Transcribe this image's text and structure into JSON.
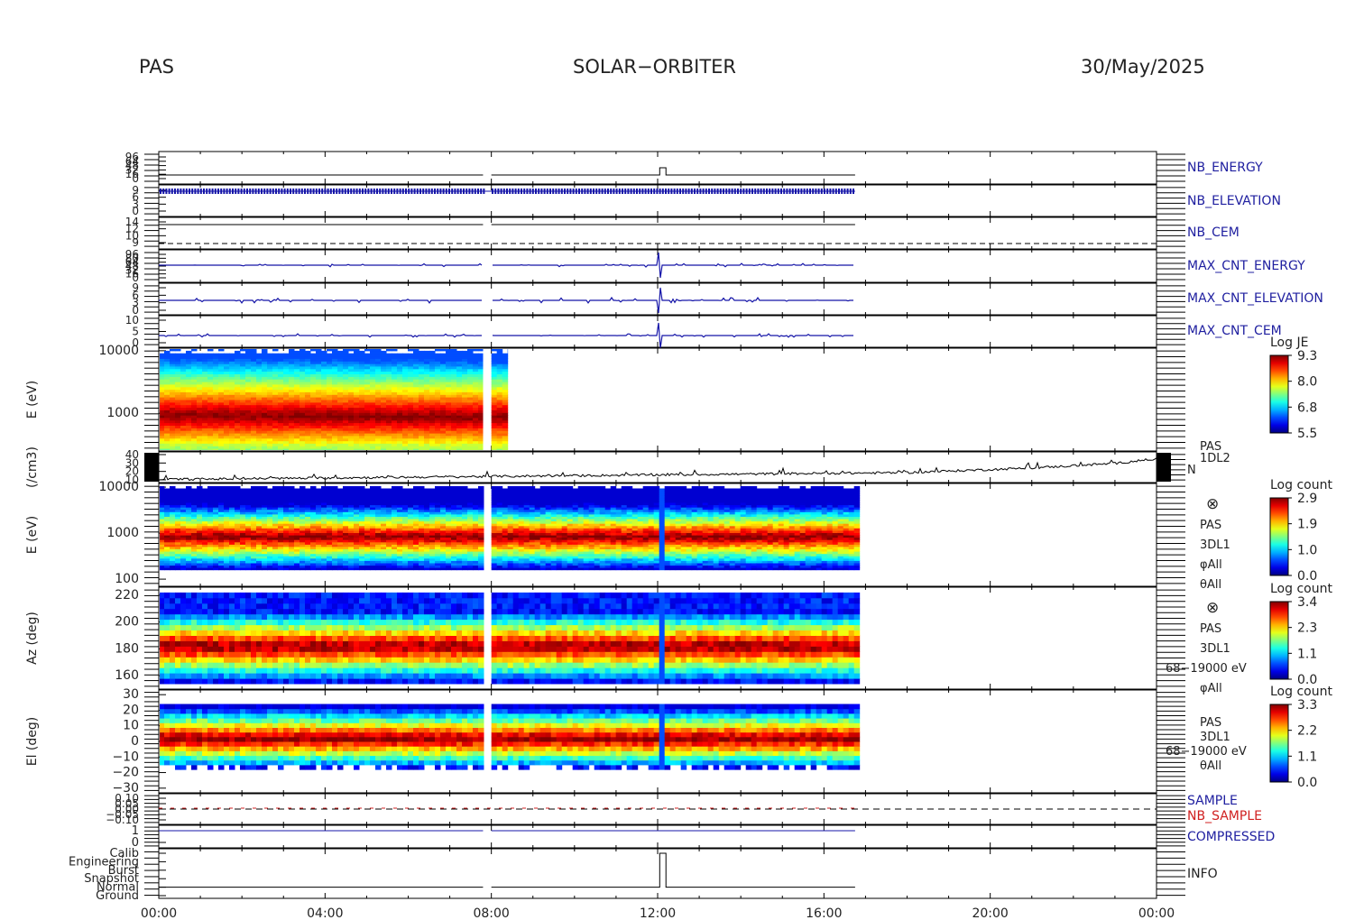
{
  "header": {
    "instrument": "PAS",
    "mission": "SOLAR−ORBITER",
    "date": "30/May/2025"
  },
  "colors": {
    "trace_blue": "#1414a8",
    "trace_black": "#000000",
    "label_blue": "#2020a0",
    "label_red": "#d02020"
  },
  "chart_data": {
    "type": "heatmap",
    "x_axis": {
      "tick_labels": [
        "00:00",
        "04:00",
        "08:00",
        "12:00",
        "16:00",
        "20:00",
        "00:00"
      ],
      "range_hours": [
        0,
        24
      ]
    },
    "data_gaps_hours": [
      [
        7.8,
        8.0
      ],
      [
        16.75,
        24
      ]
    ],
    "panels": [
      {
        "id": "nb_energy",
        "right_label": "NB_ENERGY",
        "label_color": "blue",
        "y_tick_labels": [
          "96",
          "64",
          "48",
          "32",
          "16",
          "0"
        ],
        "value_levels": [
          {
            "from": 0,
            "to": 12.05,
            "level": "low"
          },
          {
            "from": 12.05,
            "to": 12.2,
            "level": "high"
          },
          {
            "from": 12.2,
            "to": 16.75,
            "level": "low"
          }
        ]
      },
      {
        "id": "nb_elevation",
        "right_label": "NB_ELEVATION",
        "label_color": "blue",
        "y_tick_labels": [
          "9",
          "6",
          "3",
          "0"
        ],
        "style": "dense-ticks"
      },
      {
        "id": "nb_cem",
        "right_label": "NB_CEM",
        "label_color": "blue",
        "y_tick_labels": [
          "14",
          "12",
          "10",
          "9"
        ],
        "reference_line": "dashed"
      },
      {
        "id": "max_cnt_energy",
        "right_label": "MAX_CNT_ENERGY",
        "label_color": "blue",
        "y_tick_labels": [
          "96",
          "80",
          "64",
          "48",
          "32",
          "16",
          "0"
        ],
        "spike_hour": 12.05
      },
      {
        "id": "max_cnt_elevation",
        "right_label": "MAX_CNT_ELEVATION",
        "label_color": "blue",
        "y_tick_labels": [
          "9",
          "6",
          "3",
          "0"
        ],
        "spike_hour": 12.05
      },
      {
        "id": "max_cnt_cem",
        "right_label": "MAX_CNT_CEM",
        "label_color": "blue",
        "y_tick_labels": [
          "10",
          "5",
          "0"
        ],
        "spike_hour": 12.05
      },
      {
        "id": "pas_1dl2_spectrogram",
        "ylabel": "E (eV)",
        "scale": "log",
        "y_range": [
          250,
          11000
        ],
        "y_tick_labels": [
          "10000",
          "1000"
        ],
        "data_span_hours": [
          [
            0,
            7.8
          ],
          [
            8.0,
            8.4
          ]
        ],
        "peak_energy_eV": [
          950,
          880
        ],
        "colorbar": {
          "title": "Log JE",
          "tick_labels": [
            "9.3",
            "8.0",
            "6.8",
            "5.5"
          ]
        }
      },
      {
        "id": "density",
        "ylabel": "(/cm3)",
        "right_label_lines": [
          "PAS",
          "1DL2",
          "N"
        ],
        "y_tick_labels": [
          "40",
          "30",
          "20",
          "10"
        ],
        "trend_hours": [
          0,
          6,
          12,
          18,
          21,
          23,
          24
        ],
        "trend_values": [
          9,
          12,
          15,
          18,
          24,
          30,
          36
        ]
      },
      {
        "id": "pas_3dl1_energy",
        "ylabel": "E (eV)",
        "scale": "log",
        "y_range": [
          70,
          12000
        ],
        "y_tick_labels": [
          "10000",
          "1000",
          "100"
        ],
        "peak_energy_eV": 850,
        "right_label_lines": [
          "⊗",
          "PAS",
          "3DL1",
          "φAll",
          "θAll"
        ],
        "colorbar": {
          "title": "Log count",
          "tick_labels": [
            "2.9",
            "1.9",
            "1.0",
            "0.0"
          ]
        }
      },
      {
        "id": "pas_3dl1_azimuth",
        "ylabel": "Az (deg)",
        "y_range": [
          150,
          226
        ],
        "y_tick_labels": [
          "220",
          "200",
          "180",
          "160"
        ],
        "right_label_lines": [
          "⊗",
          "PAS",
          "3DL1",
          "68−19000 eV",
          "φAll"
        ],
        "colorbar": {
          "title": "Log count",
          "tick_labels": [
            "3.4",
            "2.3",
            "1.1",
            "0.0"
          ]
        }
      },
      {
        "id": "pas_3dl1_elevation",
        "ylabel": "El (deg)",
        "y_range": [
          -33,
          33
        ],
        "y_tick_labels": [
          "30",
          "20",
          "10",
          "0",
          "−10",
          "−20",
          "−30"
        ],
        "right_label_lines": [
          "PAS",
          "3DL1",
          "68−19000 eV",
          "θAll"
        ],
        "colorbar": {
          "title": "Log count",
          "tick_labels": [
            "3.3",
            "2.2",
            "1.1",
            "0.0"
          ]
        }
      },
      {
        "id": "sample",
        "right_labels": [
          {
            "text": "SAMPLE",
            "color": "blue"
          },
          {
            "text": "NB_SAMPLE",
            "color": "red"
          }
        ],
        "y_tick_labels": [
          "0.10",
          "0.05",
          "0.00",
          "−0.05",
          "−0.10"
        ]
      },
      {
        "id": "compressed",
        "right_label": "COMPRESSED",
        "label_color": "blue",
        "y_tick_labels": [
          "1",
          "0"
        ]
      },
      {
        "id": "info",
        "right_label": "INFO",
        "label_color": "black",
        "y_tick_labels": [
          "Calib",
          "Engineering",
          "Burst",
          "Snapshot",
          "Normal",
          "Ground"
        ],
        "value_levels": [
          {
            "from": 0,
            "to": 12.05,
            "level": "Normal"
          },
          {
            "from": 12.05,
            "to": 12.2,
            "level": "Calib"
          },
          {
            "from": 12.2,
            "to": 16.75,
            "level": "Normal"
          }
        ]
      }
    ]
  }
}
